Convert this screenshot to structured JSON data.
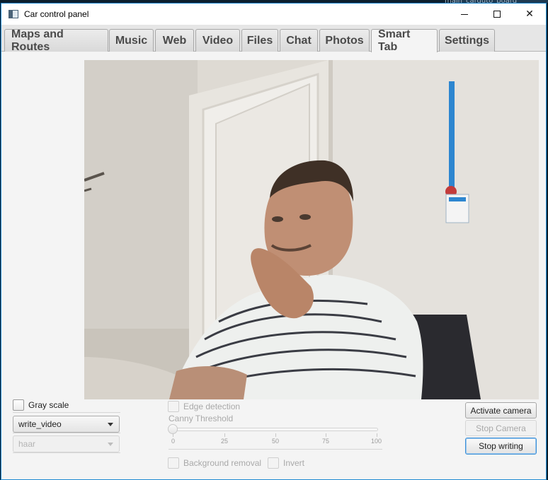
{
  "window": {
    "title": "Car control panel"
  },
  "desktop_text": "main_carduto_board",
  "tabs": [
    {
      "label": "Maps and Routes",
      "active": false
    },
    {
      "label": "Music",
      "active": false
    },
    {
      "label": "Web",
      "active": false
    },
    {
      "label": "Video",
      "active": false
    },
    {
      "label": "Files",
      "active": false
    },
    {
      "label": "Chat",
      "active": false
    },
    {
      "label": "Photos",
      "active": false
    },
    {
      "label": "Smart Tab",
      "active": true
    },
    {
      "label": "Settings",
      "active": false
    }
  ],
  "controls": {
    "grayscale_label": "Gray scale",
    "mode_select_value": "write_video",
    "classifier_select_value": "haar",
    "edge_detection_label": "Edge detection",
    "canny_label": "Canny Threshold",
    "canny_value": 0,
    "canny_ticks": [
      "0",
      "25",
      "50",
      "75",
      "100"
    ],
    "background_removal_label": "Background removal",
    "invert_label": "Invert",
    "activate_camera": "Activate camera",
    "stop_camera": "Stop Camera",
    "stop_writing": "Stop writing"
  },
  "icons": [
    "app-window-icon",
    "minimize-icon",
    "maximize-icon",
    "close-icon",
    "chevron-down-icon"
  ],
  "colors": {
    "accent": "#1f8ad2",
    "tab_text": "#4a4a4a"
  }
}
